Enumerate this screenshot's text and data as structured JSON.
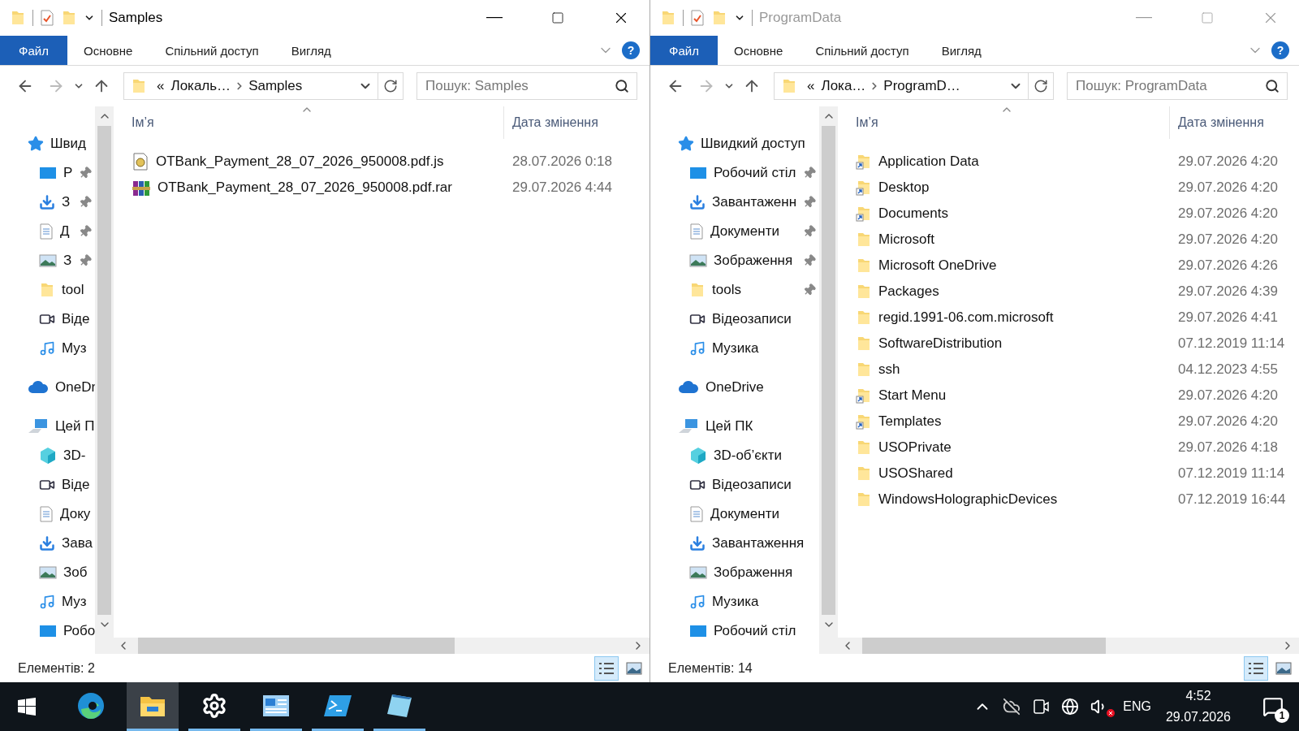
{
  "windows": [
    {
      "active": true,
      "title": "Samples",
      "ribbon": {
        "file_tab": "Файл",
        "tabs": [
          "Основне",
          "Спільний доступ",
          "Вигляд"
        ],
        "help": "?"
      },
      "address": {
        "overflow": "«",
        "crumbs": [
          "Локаль…",
          "Samples"
        ]
      },
      "search": {
        "placeholder": "Пошук: Samples"
      },
      "nav": [
        {
          "label": "Швид",
          "kind": "star",
          "children": [
            {
              "label": "Р",
              "kind": "desktop",
              "pinned": true
            },
            {
              "label": "З",
              "kind": "download",
              "pinned": true
            },
            {
              "label": "Д",
              "kind": "document",
              "pinned": true
            },
            {
              "label": "З",
              "kind": "picture",
              "pinned": true
            },
            {
              "label": "tool",
              "kind": "folder",
              "pinned": false
            },
            {
              "label": "Віде",
              "kind": "video",
              "pinned": false
            },
            {
              "label": "Муз",
              "kind": "music",
              "pinned": false
            }
          ]
        },
        {
          "label": "OneDr",
          "kind": "cloud"
        },
        {
          "label": "Цей П",
          "kind": "pc",
          "children": [
            {
              "label": "3D-",
              "kind": "cube",
              "pinned": false
            },
            {
              "label": "Віде",
              "kind": "video",
              "pinned": false
            },
            {
              "label": "Доку",
              "kind": "document",
              "pinned": false
            },
            {
              "label": "Зава",
              "kind": "download",
              "pinned": false
            },
            {
              "label": "Зоб",
              "kind": "picture",
              "pinned": false
            },
            {
              "label": "Муз",
              "kind": "music",
              "pinned": false
            },
            {
              "label": "Робо",
              "kind": "desktop",
              "pinned": false
            }
          ]
        }
      ],
      "columns": [
        "Ім’я",
        "Дата змінення"
      ],
      "files": [
        {
          "name": "OTBank_Payment_28_07_2026_950008.pdf.js",
          "date": "28.07.2026 0:18",
          "kind": "script"
        },
        {
          "name": "OTBank_Payment_28_07_2026_950008.pdf.rar",
          "date": "29.07.2026 4:44",
          "kind": "archive"
        }
      ],
      "status": "Елементів: 2",
      "views": [
        {
          "kind": "details",
          "selected": true
        },
        {
          "kind": "tiles",
          "selected": false
        }
      ]
    },
    {
      "active": false,
      "title": "ProgramData",
      "ribbon": {
        "file_tab": "Файл",
        "tabs": [
          "Основне",
          "Спільний доступ",
          "Вигляд"
        ],
        "help": "?"
      },
      "address": {
        "overflow": "«",
        "crumbs": [
          "Лока…",
          "ProgramD…"
        ]
      },
      "search": {
        "placeholder": "Пошук: ProgramData"
      },
      "nav": [
        {
          "label": "Швидкий доступ",
          "kind": "star",
          "children": [
            {
              "label": "Робочий стіл",
              "kind": "desktop",
              "pinned": true
            },
            {
              "label": "Завантаженн",
              "kind": "download",
              "pinned": true
            },
            {
              "label": "Документи",
              "kind": "document",
              "pinned": true
            },
            {
              "label": "Зображення",
              "kind": "picture",
              "pinned": true
            },
            {
              "label": "tools",
              "kind": "folder",
              "pinned": true
            },
            {
              "label": "Відеозаписи",
              "kind": "video",
              "pinned": false
            },
            {
              "label": "Музика",
              "kind": "music",
              "pinned": false
            }
          ]
        },
        {
          "label": "OneDrive",
          "kind": "cloud"
        },
        {
          "label": "Цей ПК",
          "kind": "pc",
          "children": [
            {
              "label": "3D-об’єкти",
              "kind": "cube",
              "pinned": false
            },
            {
              "label": "Відеозаписи",
              "kind": "video",
              "pinned": false
            },
            {
              "label": "Документи",
              "kind": "document",
              "pinned": false
            },
            {
              "label": "Завантаження",
              "kind": "download",
              "pinned": false
            },
            {
              "label": "Зображення",
              "kind": "picture",
              "pinned": false
            },
            {
              "label": "Музика",
              "kind": "music",
              "pinned": false
            },
            {
              "label": "Робочий стіл",
              "kind": "desktop",
              "pinned": false
            }
          ]
        }
      ],
      "columns": [
        "Ім’я",
        "Дата змінення"
      ],
      "files": [
        {
          "name": "Application Data",
          "date": "29.07.2026 4:20",
          "kind": "link"
        },
        {
          "name": "Desktop",
          "date": "29.07.2026 4:20",
          "kind": "link"
        },
        {
          "name": "Documents",
          "date": "29.07.2026 4:20",
          "kind": "link"
        },
        {
          "name": "Microsoft",
          "date": "29.07.2026 4:20",
          "kind": "folder"
        },
        {
          "name": "Microsoft OneDrive",
          "date": "29.07.2026 4:26",
          "kind": "folder"
        },
        {
          "name": "Packages",
          "date": "29.07.2026 4:39",
          "kind": "folder"
        },
        {
          "name": "regid.1991-06.com.microsoft",
          "date": "29.07.2026 4:41",
          "kind": "folder"
        },
        {
          "name": "SoftwareDistribution",
          "date": "07.12.2019 11:14",
          "kind": "folder"
        },
        {
          "name": "ssh",
          "date": "04.12.2023 4:55",
          "kind": "folder"
        },
        {
          "name": "Start Menu",
          "date": "29.07.2026 4:20",
          "kind": "link"
        },
        {
          "name": "Templates",
          "date": "29.07.2026 4:20",
          "kind": "link"
        },
        {
          "name": "USOPrivate",
          "date": "29.07.2026 4:18",
          "kind": "folder"
        },
        {
          "name": "USOShared",
          "date": "07.12.2019 11:14",
          "kind": "folder"
        },
        {
          "name": "WindowsHolographicDevices",
          "date": "07.12.2019 16:44",
          "kind": "folder"
        }
      ],
      "status": "Елементів: 14",
      "views": [
        {
          "kind": "details",
          "selected": true
        },
        {
          "kind": "tiles",
          "selected": false
        }
      ]
    }
  ],
  "taskbar": {
    "apps": [
      {
        "kind": "edge",
        "running": false,
        "selected": false
      },
      {
        "kind": "explorer",
        "running": true,
        "selected": true
      },
      {
        "kind": "settings",
        "running": true,
        "selected": false
      },
      {
        "kind": "control",
        "running": true,
        "selected": false
      },
      {
        "kind": "terminal",
        "running": true,
        "selected": false
      },
      {
        "kind": "notepad",
        "running": true,
        "selected": false
      }
    ],
    "language": "ENG",
    "time": "4:52",
    "date": "29.07.2026",
    "notifications": "1"
  }
}
